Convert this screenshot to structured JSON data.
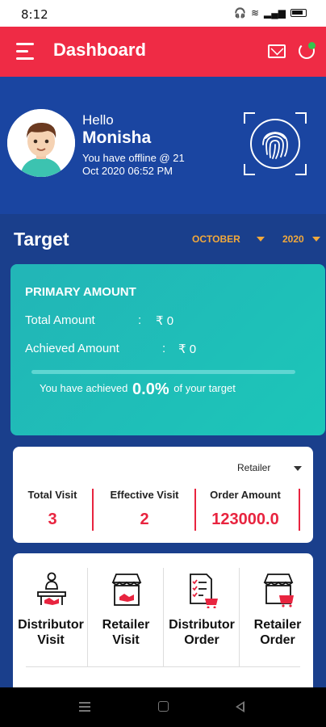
{
  "status_bar": {
    "time": "8:12"
  },
  "header": {
    "title": "Dashboard",
    "menu_icon": "hamburger-menu-icon",
    "mail_icon": "mail-icon",
    "sync_icon": "sync-icon"
  },
  "profile": {
    "greeting": "Hello",
    "name": "Monisha",
    "offline_text": "You have offline @ 21 Oct 2020 06:52 PM",
    "fingerprint_icon": "fingerprint-icon"
  },
  "target": {
    "title": "Target",
    "month": "OCTOBER",
    "year": "2020"
  },
  "primary_card": {
    "title": "PRIMARY AMOUNT",
    "total_label": "Total Amount",
    "total_colon": ":",
    "total_value": "₹ 0",
    "achieved_label": "Achieved Amount",
    "achieved_colon": ":",
    "achieved_value": "₹ 0",
    "achieve_prefix": "You have achieved",
    "achieve_percent": "0.0%",
    "achieve_suffix": "of your target",
    "progress_fraction": 0.0
  },
  "stats": {
    "filter": "Retailer",
    "items": [
      {
        "label": "Total Visit",
        "value": "3"
      },
      {
        "label": "Effective Visit",
        "value": "2"
      },
      {
        "label": "Order Amount",
        "value": "123000.0"
      }
    ]
  },
  "menu": {
    "tiles": [
      {
        "label": "Distributor Visit",
        "icon": "distributor-visit-icon"
      },
      {
        "label": "Retailer Visit",
        "icon": "retailer-visit-icon"
      },
      {
        "label": "Distributor Order",
        "icon": "distributor-order-icon"
      },
      {
        "label": "Retailer Order",
        "icon": "retailer-order-icon"
      }
    ]
  },
  "colors": {
    "header": "#ef2b45",
    "accent": "#e8243f",
    "card_teal": "#1cc6b8",
    "background": "#1a3f8c",
    "dropdown": "#f2a93b"
  }
}
